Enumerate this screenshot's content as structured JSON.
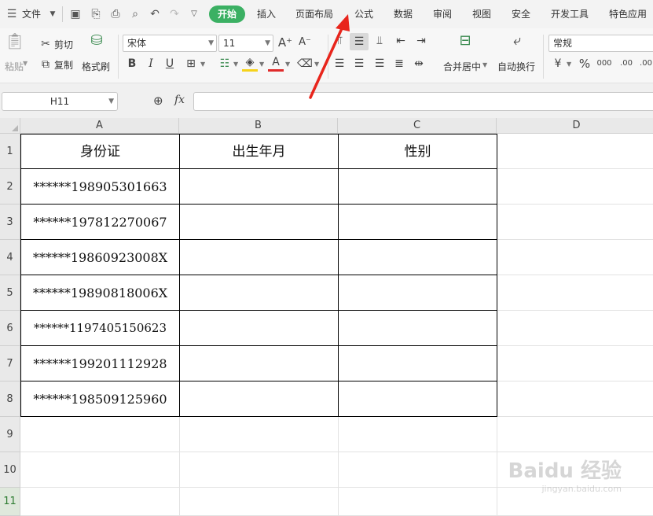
{
  "menu": {
    "file": "文件",
    "tabs": [
      "开始",
      "插入",
      "页面布局",
      "公式",
      "数据",
      "审阅",
      "视图",
      "安全",
      "开发工具",
      "特色应用"
    ]
  },
  "ribbon": {
    "paste": "粘贴",
    "cut": "剪切",
    "copy": "复制",
    "format_painter": "格式刷",
    "font_name": "宋体",
    "font_size": "11",
    "bold": "B",
    "italic": "I",
    "underline": "U",
    "font_color_letter": "A",
    "merge_center": "合并居中",
    "wrap_text": "自动换行",
    "number_format": "常规",
    "percent": "%",
    "thousands": "000",
    "inc_decimal": ".00",
    "dec_decimal": ".00"
  },
  "formula_bar": {
    "name_box": "H11",
    "fx": "fx",
    "value": ""
  },
  "sheet": {
    "columns": [
      "A",
      "B",
      "C",
      "D"
    ],
    "rows": [
      "1",
      "2",
      "3",
      "4",
      "5",
      "6",
      "7",
      "8",
      "9",
      "10",
      "11"
    ],
    "headers": [
      "身份证",
      "出生年月",
      "性别"
    ],
    "id_numbers": [
      "******198905301663",
      "******197812270067",
      "******19860923008X",
      "******19890818006X",
      "******1197405150623",
      "******199201112928",
      "******198509125960"
    ]
  },
  "colors": {
    "active_tab": "#3bb063",
    "annotation_arrow": "#e8251c"
  },
  "watermark": {
    "brand": "Baidu 经验",
    "url": "jingyan.baidu.com"
  }
}
